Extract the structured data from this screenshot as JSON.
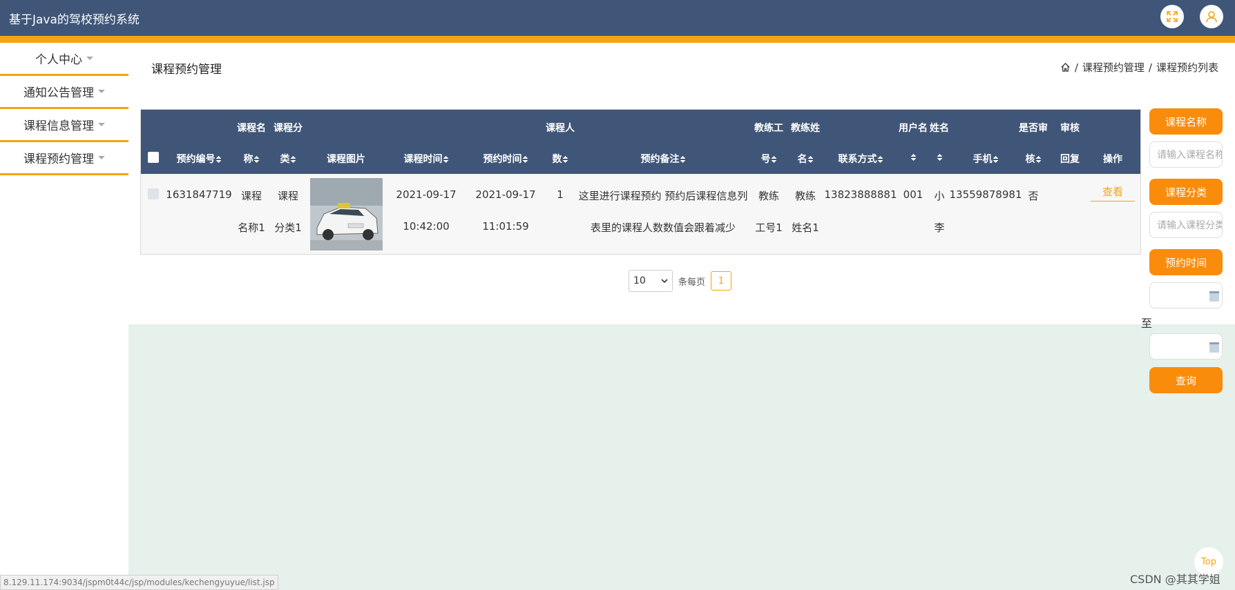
{
  "app": {
    "title": "基于Java的驾校预约系统"
  },
  "sidebar": {
    "items": [
      {
        "label": "个人中心"
      },
      {
        "label": "通知公告管理"
      },
      {
        "label": "课程信息管理"
      },
      {
        "label": "课程预约管理"
      }
    ]
  },
  "page": {
    "heading": "课程预约管理",
    "breadcrumb": [
      "课程预约管理",
      "课程预约列表"
    ],
    "breadcrumb_sep": "/"
  },
  "table": {
    "columns": [
      {
        "top": "",
        "bottom": "预约编号"
      },
      {
        "top": "课程名",
        "bottom": "称"
      },
      {
        "top": "课程分",
        "bottom": "类"
      },
      {
        "top": "",
        "bottom": "课程图片"
      },
      {
        "top": "",
        "bottom": "课程时间"
      },
      {
        "top": "",
        "bottom": "预约时间"
      },
      {
        "top": "课程人",
        "bottom": "数"
      },
      {
        "top": "",
        "bottom": "预约备注"
      },
      {
        "top": "教练工",
        "bottom": "号"
      },
      {
        "top": "教练姓",
        "bottom": "名"
      },
      {
        "top": "",
        "bottom": "联系方式"
      },
      {
        "top": "用户名",
        "bottom": ""
      },
      {
        "top": "姓名",
        "bottom": ""
      },
      {
        "top": "",
        "bottom": "手机"
      },
      {
        "top": "是否审",
        "bottom": "核"
      },
      {
        "top": "审核",
        "bottom": "回复"
      },
      {
        "top": "",
        "bottom": "操作"
      }
    ],
    "rows": [
      {
        "id": "1631847719",
        "course_name": [
          "课程",
          "名称1"
        ],
        "course_type": [
          "课程",
          "分类1"
        ],
        "course_time": [
          "2021-09-17",
          "10:42:00"
        ],
        "booking_time": [
          "2021-09-17",
          "11:01:59"
        ],
        "count": "1",
        "remark": [
          "这里进行课程预约 预约后课程信息列",
          "表里的课程人数数值会跟着减少"
        ],
        "coach_no": [
          "教练",
          "工号1"
        ],
        "coach_name": [
          "教练",
          "姓名1"
        ],
        "contact": "13823888881",
        "username": "001",
        "name": [
          "小",
          "李"
        ],
        "phone": "13559878981",
        "reviewed": "否",
        "reply": "",
        "action": "查看"
      }
    ]
  },
  "pagination": {
    "page_size": "10",
    "per_page_label": "条每页",
    "current_page": "1"
  },
  "search": {
    "course_name_label": "课程名称",
    "course_name_placeholder": "请输入课程名称",
    "course_type_label": "课程分类",
    "course_type_placeholder": "请输入课程分类",
    "booking_time_label": "预约时间",
    "range_to": "至",
    "query_label": "查询"
  },
  "misc": {
    "top_button": "Top",
    "watermark": "CSDN @其其学姐",
    "status_url": "8.129.11.174:9034/jspm0t44c/jsp/modules/kechengyuyue/list.jsp"
  },
  "colors": {
    "header": "#3f5678",
    "accent": "#f5a30f",
    "button": "#fa8c0c",
    "content_bg": "#e6f1ec"
  }
}
